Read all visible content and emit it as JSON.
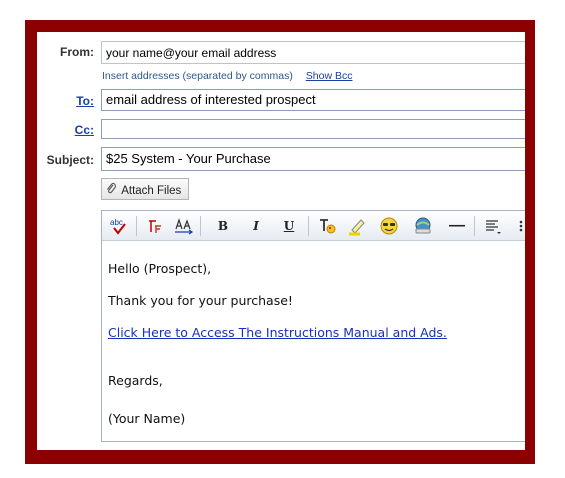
{
  "compose": {
    "from_label": "From:",
    "from_value": "your name@your email address",
    "insert_hint": "Insert addresses (separated by commas)",
    "show_bcc": "Show Bcc",
    "to_label": "To:",
    "to_value": "email address of interested prospect",
    "cc_label": "Cc:",
    "cc_value": "",
    "subject_label": "Subject:",
    "subject_value": "$25 System - Your Purchase",
    "attach_label": "Attach Files"
  },
  "toolbar": {
    "spell": "abc",
    "bold": "B",
    "italic": "I",
    "underline": "U",
    "hr": "—"
  },
  "body": {
    "greeting": "Hello (Prospect),",
    "thanks": "Thank you for your purchase!",
    "link_text": "Click Here to Access The Instructions Manual and Ads.",
    "regards": "Regards,",
    "signature": "(Your Name)"
  },
  "colors": {
    "frame": "#8b0000",
    "link": "#1a3fa6"
  }
}
